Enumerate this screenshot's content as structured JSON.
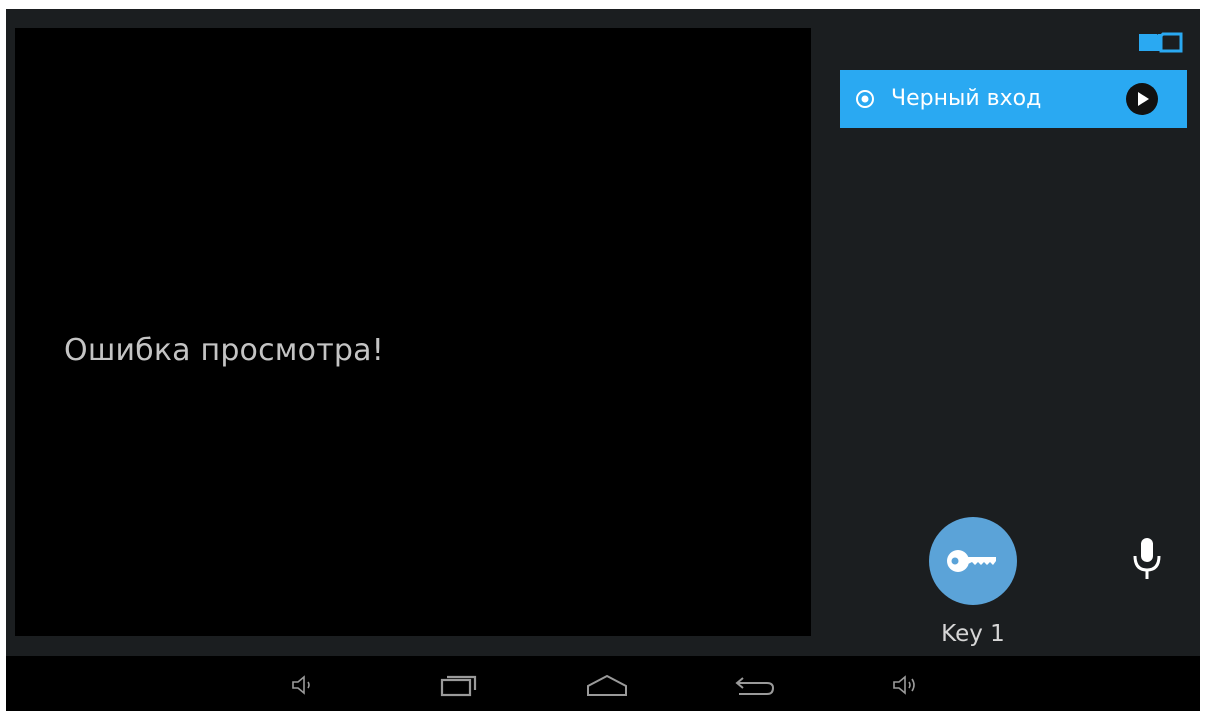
{
  "video": {
    "error_text": "Ошибка просмотра!"
  },
  "header": {
    "icon": "book-icon"
  },
  "cameras": [
    {
      "label": "Черный вход",
      "selected": true,
      "icon_left": "radio-selected-icon",
      "icon_right": "play-icon"
    }
  ],
  "controls": {
    "key_label": "Key 1",
    "key_icon": "key-icon",
    "mic_icon": "microphone-icon"
  },
  "navbar": {
    "items": [
      "volume-down-icon",
      "recent-apps-icon",
      "home-icon",
      "back-icon",
      "volume-up-icon"
    ]
  },
  "colors": {
    "accent": "#2aa9f2",
    "key_button": "#5ba3d8",
    "panel_bg": "#1b1e20",
    "video_bg": "#000000",
    "text": "#c4c4c4"
  }
}
